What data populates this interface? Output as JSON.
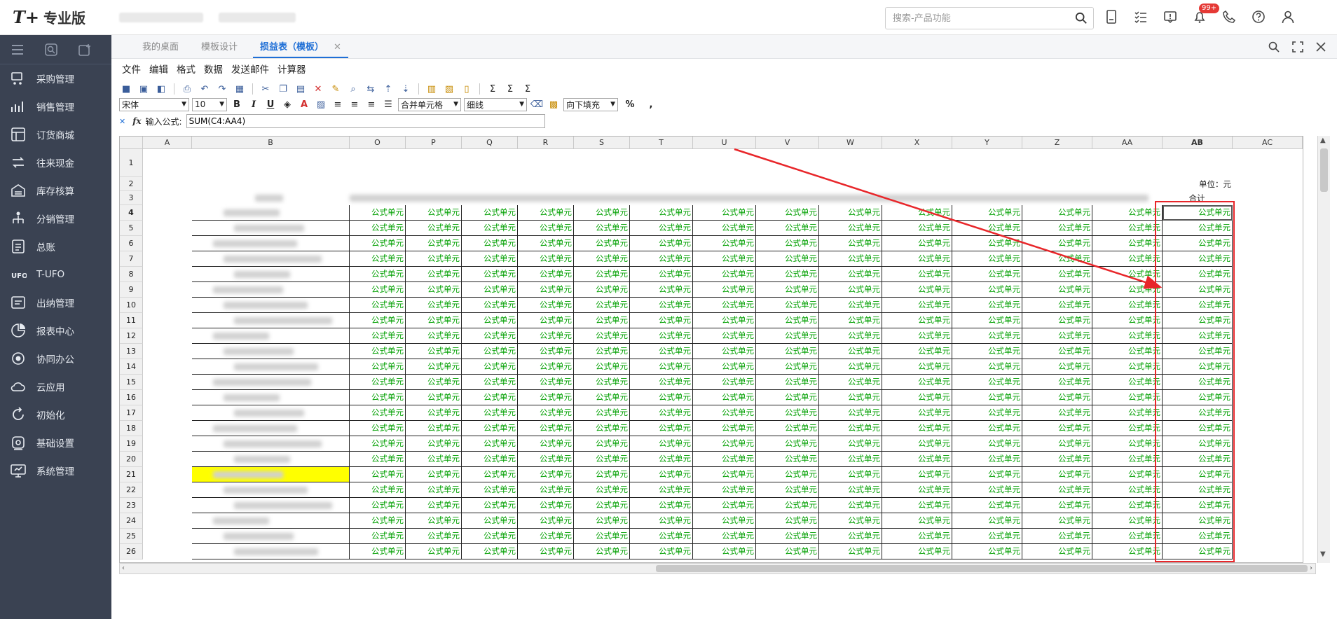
{
  "header": {
    "logo_mark": "T+",
    "app_name": "专业版",
    "search_placeholder": "搜索-产品功能",
    "badge": "99+",
    "icons": [
      "device-icon",
      "checklist-icon",
      "feedback-icon",
      "bell-icon",
      "phone-icon",
      "help-icon",
      "user-icon"
    ]
  },
  "sidebar": {
    "items": [
      {
        "label": "采购管理",
        "icon": "purchase-icon"
      },
      {
        "label": "销售管理",
        "icon": "sales-icon"
      },
      {
        "label": "订货商城",
        "icon": "mall-icon"
      },
      {
        "label": "往来现金",
        "icon": "cash-icon"
      },
      {
        "label": "库存核算",
        "icon": "inventory-icon"
      },
      {
        "label": "分销管理",
        "icon": "distribution-icon"
      },
      {
        "label": "总账",
        "icon": "ledger-icon"
      },
      {
        "label": "T-UFO",
        "icon": "ufo-icon"
      },
      {
        "label": "出纳管理",
        "icon": "cashier-icon"
      },
      {
        "label": "报表中心",
        "icon": "report-icon"
      },
      {
        "label": "协同办公",
        "icon": "office-icon"
      },
      {
        "label": "云应用",
        "icon": "cloud-icon"
      },
      {
        "label": "初始化",
        "icon": "init-icon"
      },
      {
        "label": "基础设置",
        "icon": "settings-icon"
      },
      {
        "label": "系统管理",
        "icon": "system-icon"
      }
    ]
  },
  "tabs": [
    {
      "label": "我的桌面"
    },
    {
      "label": "模板设计"
    },
    {
      "label": "损益表（模板）",
      "active": true,
      "close": "✕"
    }
  ],
  "menu": [
    "文件",
    "编辑",
    "格式",
    "数据",
    "发送邮件",
    "计算器"
  ],
  "toolbar2": {
    "font": "宋体",
    "size": "10",
    "bold": "B",
    "italic": "I",
    "underline": "U",
    "merge": "合并单元格",
    "border": "细线",
    "fill": "向下填充",
    "percent": "%",
    "comma": ","
  },
  "formula": {
    "label": "输入公式:",
    "value": "SUM(C4:AA4)"
  },
  "sheet": {
    "columns": [
      "A",
      "B",
      "O",
      "P",
      "Q",
      "R",
      "S",
      "T",
      "U",
      "V",
      "W",
      "X",
      "Y",
      "Z",
      "AA",
      "AB",
      "AC"
    ],
    "unit_label": "单位：元",
    "total_header": "合计",
    "cell_text": "公式单元",
    "first_row": 1,
    "last_row": 26
  },
  "colors": {
    "sidebar_bg": "#3a4252",
    "accent": "#1f6fd6",
    "formula_cell": "#00a000",
    "highlight_row": "#ffff00",
    "annotation": "#e8262a"
  }
}
